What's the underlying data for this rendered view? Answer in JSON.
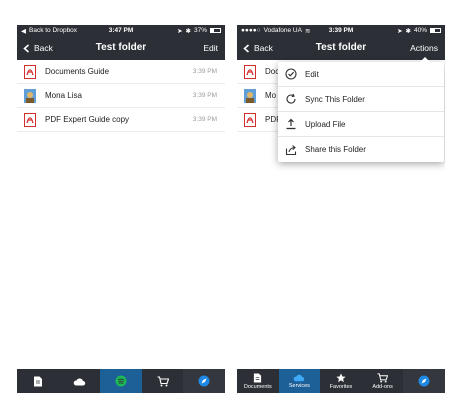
{
  "colors": {
    "bar": "#2c3036",
    "active_tab": "#1d5f97",
    "pdf_red": "#d32f2f"
  },
  "left": {
    "status": {
      "back_to": "Back to Dropbox",
      "time": "3:47 PM",
      "battery": "37%",
      "battery_level": 0.37
    },
    "nav": {
      "back_label": "Back",
      "title": "Test folder",
      "action_label": "Edit"
    },
    "files": [
      {
        "name": "Documents Guide",
        "time": "3:39 PM",
        "icon": "pdf-icon"
      },
      {
        "name": "Mona Lisa",
        "time": "3:39 PM",
        "icon": "image-icon"
      },
      {
        "name": "PDF Expert Guide copy",
        "time": "3:39 PM",
        "icon": "pdf-icon"
      }
    ],
    "tabs": [
      {
        "icon": "document-icon"
      },
      {
        "icon": "cloud-icon"
      },
      {
        "icon": "spotify-icon"
      },
      {
        "icon": "cart-icon"
      },
      {
        "icon": "compass-icon"
      }
    ]
  },
  "right": {
    "status": {
      "carrier": "Vodafone UA",
      "time": "3:39 PM",
      "battery": "40%",
      "battery_level": 0.4
    },
    "nav": {
      "back_label": "Back",
      "title": "Test folder",
      "action_label": "Actions"
    },
    "files": [
      {
        "name": "Doc",
        "icon": "pdf-icon"
      },
      {
        "name": "Mo",
        "icon": "image-icon"
      },
      {
        "name": "PDF",
        "icon": "pdf-icon"
      }
    ],
    "menu": [
      {
        "label": "Edit",
        "icon": "check-circle-icon"
      },
      {
        "label": "Sync This Folder",
        "icon": "sync-icon"
      },
      {
        "label": "Upload File",
        "icon": "upload-icon"
      },
      {
        "label": "Share this Folder",
        "icon": "share-icon"
      }
    ],
    "tabs": [
      {
        "label": "Documents",
        "icon": "document-icon"
      },
      {
        "label": "Services",
        "icon": "cloud-icon"
      },
      {
        "label": "Favorites",
        "icon": "star-icon"
      },
      {
        "label": "Add-ons",
        "icon": "cart-icon"
      },
      {
        "label": "",
        "icon": "compass-icon"
      }
    ]
  }
}
